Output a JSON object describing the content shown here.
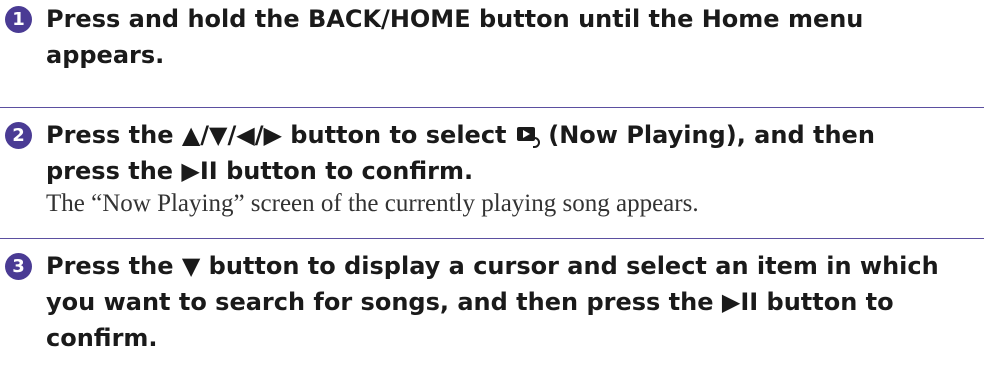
{
  "steps": [
    {
      "number": "1",
      "title": "Press and hold the BACK/HOME button until the Home menu\nappears."
    },
    {
      "number": "2",
      "title_before_icon": "Press the ▲/▼/◀/▶ button to select ",
      "icon": "now-playing-icon",
      "title_after_icon": " (Now Playing), and then\npress the ▶II button to confirm.",
      "body": "The “Now Playing” screen of the currently playing song appears."
    },
    {
      "number": "3",
      "title": "Press the ▼ button to display a cursor and select an item in which\nyou want to search for songs, and then press the ▶II button to\nconfirm."
    }
  ],
  "colors": {
    "badge": "#4a3b94",
    "rule": "#5b4fa0",
    "text": "#1a1a1a",
    "body_text": "#333333"
  }
}
